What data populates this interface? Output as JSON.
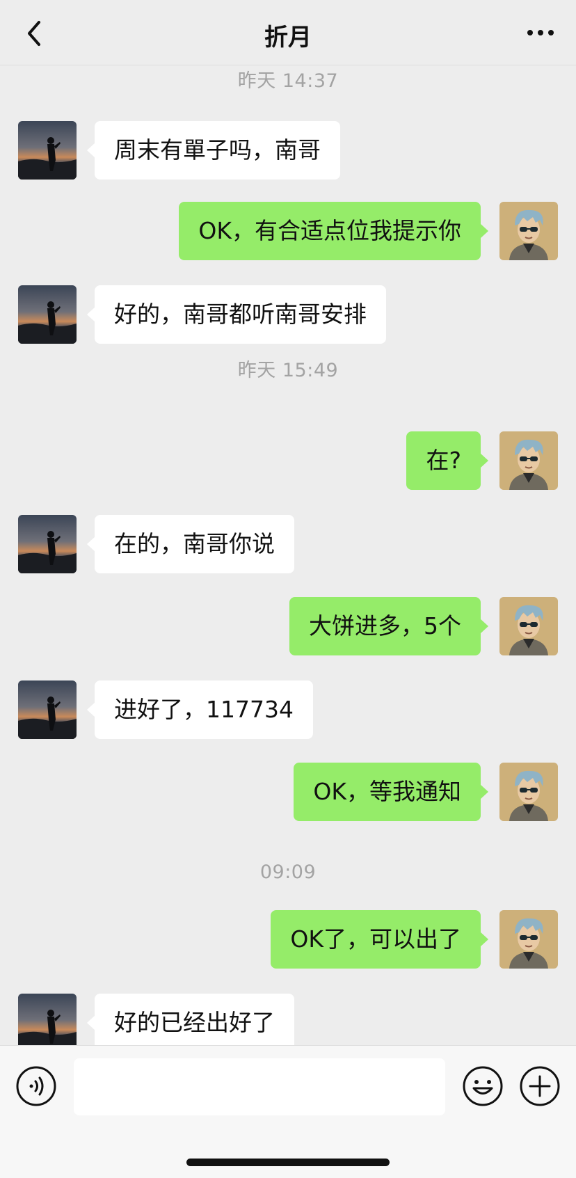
{
  "header": {
    "title": "折月"
  },
  "icons": {
    "back": "chevron-left-icon",
    "more": "more-dots-icon",
    "voice": "voice-icon",
    "emoji": "emoji-icon",
    "plus": "plus-icon"
  },
  "colors": {
    "outgoing_bubble": "#95ec69",
    "incoming_bubble": "#ffffff",
    "background": "#ededed"
  },
  "timestamps": [
    "昨天 14:37",
    "昨天 15:49",
    "09:09"
  ],
  "messages": [
    {
      "from": "contact",
      "text": "周末有單子吗，南哥"
    },
    {
      "from": "me",
      "text": "OK，有合适点位我提示你"
    },
    {
      "from": "contact",
      "text": "好的，南哥都听南哥安排"
    },
    {
      "from": "me",
      "text": "在?"
    },
    {
      "from": "contact",
      "text": "在的，南哥你说"
    },
    {
      "from": "me",
      "text": "大饼进多，5个"
    },
    {
      "from": "contact",
      "text": "进好了，117734"
    },
    {
      "from": "me",
      "text": "OK，等我通知"
    },
    {
      "from": "me",
      "text": "OK了，可以出了"
    },
    {
      "from": "contact",
      "text": "好的已经出好了"
    }
  ],
  "input": {
    "value": ""
  }
}
